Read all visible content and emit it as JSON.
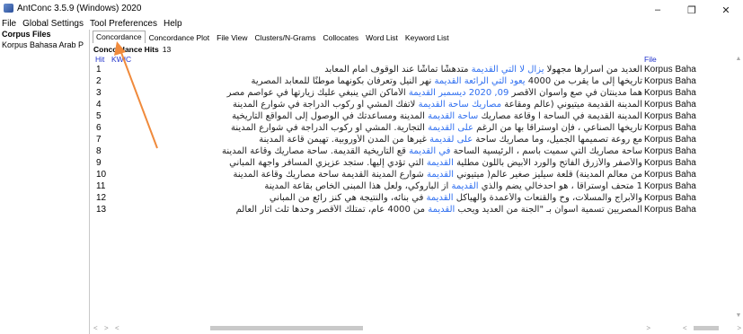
{
  "window": {
    "title": "AntConc 3.5.9 (Windows) 2020",
    "minimize": "–",
    "maximize": "❐",
    "close": "✕"
  },
  "menu": [
    "File",
    "Global Settings",
    "Tool Preferences",
    "Help"
  ],
  "sidebar": {
    "title": "Corpus Files",
    "files": [
      "Korpus Bahasa Arab P"
    ]
  },
  "tabs": [
    "Concordance",
    "Concordance Plot",
    "File View",
    "Clusters/N-Grams",
    "Collocates",
    "Word List",
    "Keyword List"
  ],
  "hits": {
    "label": "Concordance Hits",
    "count": "13"
  },
  "columns": {
    "hit": "Hit",
    "kwic": "KWIC",
    "file": "File"
  },
  "rows": [
    {
      "n": "1",
      "right": "العديد من أسرارها مجهولا",
      "kw": "يزال لا التي القديمة",
      "left": "متدهشًا تماشًا عند الوقوف أمام المعابد",
      "file": "Korpus Baha"
    },
    {
      "n": "2",
      "right": "تاريخها إلى ما يقرب من 4000",
      "kw": "يعود التي الرائعة القديمة",
      "left": "نهر النيل وتعرفان بكونهما موطنًا للمعابد المصرية",
      "file": "Korpus Baha"
    },
    {
      "n": "3",
      "right": "هما مدينتان في صع وأسوان الأقصر",
      "kw": "09, 2020 ديسمبر القديمة",
      "left": "الأماكن التي ينبغي عليك زيارتها في عواصم مصر",
      "file": "Korpus Baha"
    },
    {
      "n": "4",
      "right": "المدينة القديمة ميتيوني (عالم ومقاعة",
      "kw": "مصاريك ساحة القديمة",
      "left": "لاتفك المشي أو ركوب الدراجة في شوارع المدينة",
      "file": "Korpus Baha"
    },
    {
      "n": "5",
      "right": "المدينة القديمة في الساحة ا وقاعة مصاريك",
      "kw": "ساحة القديمة",
      "left": "المدينة ومساعدتك في الوصول إلى المواقع التاريخية",
      "file": "Korpus Baha"
    },
    {
      "n": "6",
      "right": "تاريخها الصناعي ، فإن أوستراقا بها من الرغم",
      "kw": "على القديمة",
      "left": "التجارية. المشي أو ركوب الدراجة في شوارع المدينة",
      "file": "Korpus Baha"
    },
    {
      "n": "7",
      "right": "مع روعة تصميمها الجميل، وما مصاريك ساحة",
      "kw": "على لقديمة",
      "left": "غيرها من المدن الأوروبية. تهيمن قاعة المدينة",
      "file": "Korpus Baha"
    },
    {
      "n": "8",
      "right": "ساحة مصاريك التي سميت باسم ، الرئيسية الساحة",
      "kw": "في القديمة",
      "left": "قع التاريخية القديمة. ساحة مصاريك وقاعة المدينة",
      "file": "Korpus Baha"
    },
    {
      "n": "9",
      "right": "والأصفر والأزرق الفاتح والورد الأبيض باللون مطلية",
      "kw": "القديمة",
      "left": "التي تؤدي إليها. ستجد عزيزي المسافر واجهة المباني",
      "file": "Korpus Baha"
    },
    {
      "n": "10",
      "right": "من معالم المدينة) قلعة سيليز صغير عالم( ميتيوني",
      "kw": "القديمة",
      "left": "شوارع المدينة القديمة ساحة مصاريك وقاعة المدينة",
      "file": "Korpus Baha"
    },
    {
      "n": "11",
      "right": "ً1 متحف أوستراقا ، هو أحدخالي يضم والذي",
      "kw": "القديمة",
      "left": "از الباروكي، ولعل هذا المبنى الخاص بقاعة المدينة",
      "file": "Korpus Baha"
    },
    {
      "n": "12",
      "right": "والأبراج والمسلات، وح والقنعات والأعمدة والهياكل",
      "kw": "القديمة",
      "left": "في بنائه، والنتيجة هي كنز رائع من المباني",
      "file": "Korpus Baha"
    },
    {
      "n": "13",
      "right": "المصريين تسمية أسوان بـ \"الجنة من العديد ويحب",
      "kw": "القديمة",
      "left": "من 4000 عام، تمتلك الأقصر وحدها ثلث آثار العالم",
      "file": "Korpus Baha"
    }
  ],
  "colors": {
    "keyword": "#2f6ff0",
    "header": "#2233cc",
    "arrow": "#f08a3c"
  }
}
